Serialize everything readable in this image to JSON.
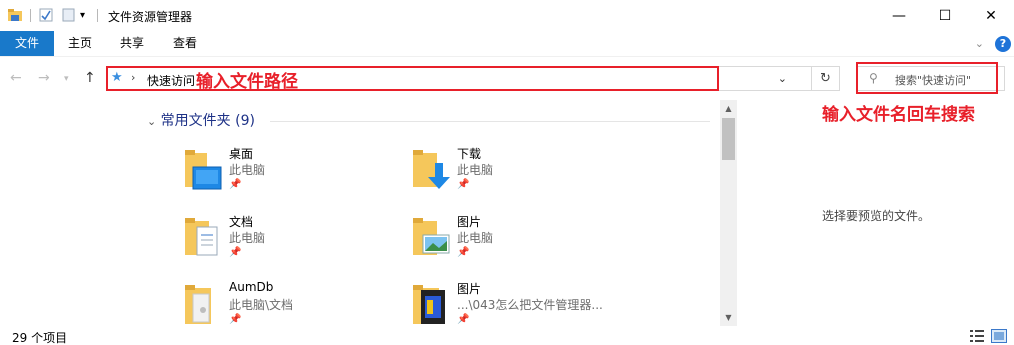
{
  "window": {
    "title": "文件资源管理器",
    "minimize_glyph": "—",
    "maximize_glyph": "☐",
    "close_glyph": "✕"
  },
  "ribbon": {
    "tabs": [
      {
        "label": "文件",
        "active": true
      },
      {
        "label": "主页"
      },
      {
        "label": "共享"
      },
      {
        "label": "查看"
      }
    ],
    "expand_glyph": "⌄",
    "help_glyph": "?"
  },
  "nav": {
    "breadcrumb": "快速访问",
    "search_placeholder": "搜索\"快速访问\"",
    "annotation_address": "输入文件路径",
    "annotation_search": "输入文件名回车搜索"
  },
  "quick_access": {
    "group_label": "常用文件夹 (9)",
    "items": [
      {
        "name": "桌面",
        "location": "此电脑",
        "icon": "desktop-folder-icon"
      },
      {
        "name": "下载",
        "location": "此电脑",
        "icon": "downloads-folder-icon"
      },
      {
        "name": "文档",
        "location": "此电脑",
        "icon": "documents-folder-icon"
      },
      {
        "name": "图片",
        "location": "此电脑",
        "icon": "pictures-folder-icon"
      },
      {
        "name": "AumDb",
        "location": "此电脑\\文档",
        "icon": "folder-icon"
      },
      {
        "name": "图片",
        "location": "...\\043怎么把文件管理器...",
        "icon": "image-folder-icon"
      }
    ]
  },
  "preview": {
    "hint": "选择要预览的文件。"
  },
  "status": {
    "item_count": "29 个项目"
  },
  "colors": {
    "accent": "#1979ca",
    "annotation": "#e8202a",
    "folder": "#f5c75b"
  }
}
